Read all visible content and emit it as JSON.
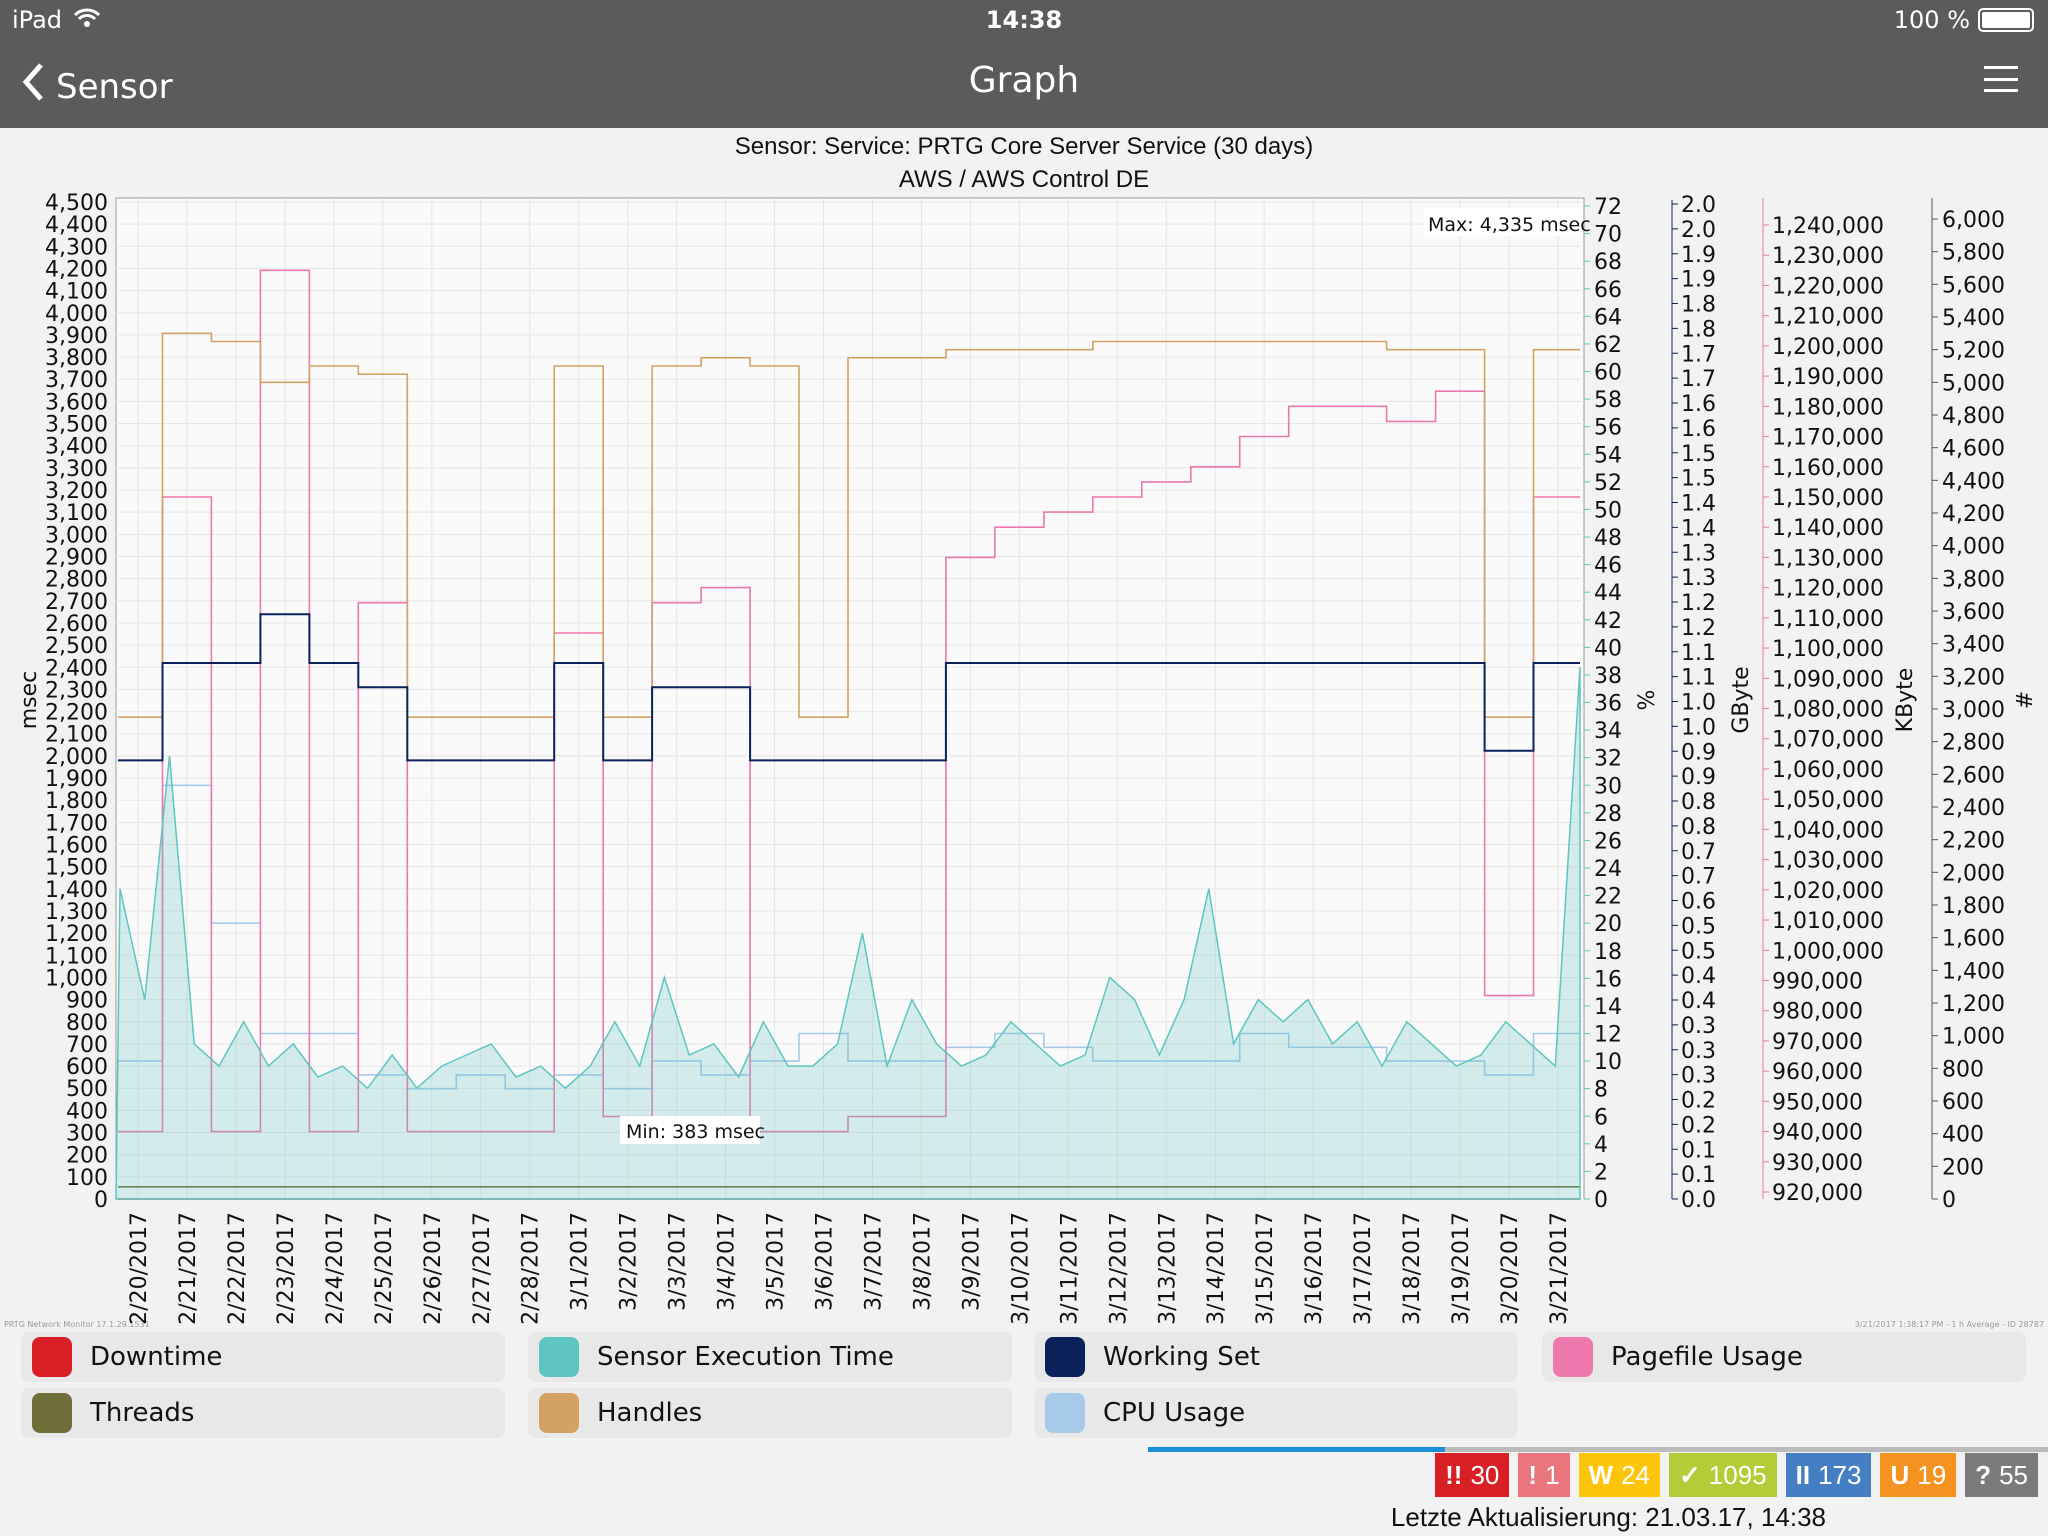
{
  "status_bar": {
    "device": "iPad",
    "time": "14:38",
    "battery": "100 %",
    "battery_level": 1.0
  },
  "nav": {
    "back_label": "Sensor",
    "title": "Graph"
  },
  "chart_header": {
    "line1": "Sensor: Service: PRTG Core Server Service (30 days)",
    "line2": "AWS / AWS Control DE"
  },
  "footer": {
    "left": "PRTG Network Monitor 17.1.29.1531",
    "right": "3/21/2017 1:38:17 PM - 1 h Average - ID 28787"
  },
  "chart_data": {
    "type": "line",
    "annotations": {
      "max": "Max: 4,335 msec",
      "min": "Min: 383 msec"
    },
    "grid": true,
    "x_ticks": [
      "2/20/2017",
      "2/21/2017",
      "2/22/2017",
      "2/23/2017",
      "2/24/2017",
      "2/25/2017",
      "2/26/2017",
      "2/27/2017",
      "2/28/2017",
      "3/1/2017",
      "3/2/2017",
      "3/3/2017",
      "3/4/2017",
      "3/5/2017",
      "3/6/2017",
      "3/7/2017",
      "3/8/2017",
      "3/9/2017",
      "3/10/2017",
      "3/11/2017",
      "3/12/2017",
      "3/13/2017",
      "3/14/2017",
      "3/15/2017",
      "3/16/2017",
      "3/17/2017",
      "3/18/2017",
      "3/19/2017",
      "3/20/2017",
      "3/21/2017"
    ],
    "axes": {
      "msec": {
        "label": "msec",
        "range": [
          0,
          4500
        ],
        "ticks": [
          "0",
          "100",
          "200",
          "300",
          "400",
          "500",
          "600",
          "700",
          "800",
          "900",
          "1,000",
          "1,100",
          "1,200",
          "1,300",
          "1,400",
          "1,500",
          "1,600",
          "1,700",
          "1,800",
          "1,900",
          "2,000",
          "2,100",
          "2,200",
          "2,300",
          "2,400",
          "2,500",
          "2,600",
          "2,700",
          "2,800",
          "2,900",
          "3,000",
          "3,100",
          "3,200",
          "3,300",
          "3,400",
          "3,500",
          "3,600",
          "3,700",
          "3,800",
          "3,900",
          "4,000",
          "4,100",
          "4,200",
          "4,300",
          "4,400",
          "4,500"
        ]
      },
      "percent": {
        "label": "%",
        "range": [
          0,
          72
        ],
        "ticks": [
          "0",
          "2",
          "4",
          "6",
          "8",
          "10",
          "12",
          "14",
          "16",
          "18",
          "20",
          "22",
          "24",
          "26",
          "28",
          "30",
          "32",
          "34",
          "36",
          "38",
          "40",
          "42",
          "44",
          "46",
          "48",
          "50",
          "52",
          "54",
          "56",
          "58",
          "60",
          "62",
          "64",
          "66",
          "68",
          "70",
          "72"
        ]
      },
      "gbyte": {
        "label": "GByte",
        "range": [
          0,
          2.05
        ],
        "ticks": [
          "0.0",
          "0.1",
          "0.1",
          "0.2",
          "0.2",
          "0.3",
          "0.3",
          "0.3",
          "0.4",
          "0.4",
          "0.5",
          "0.5",
          "0.6",
          "0.7",
          "0.7",
          "0.8",
          "0.8",
          "0.9",
          "0.9",
          "1.0",
          "1.0",
          "1.1",
          "1.1",
          "1.2",
          "1.2",
          "1.3",
          "1.3",
          "1.4",
          "1.4",
          "1.5",
          "1.5",
          "1.6",
          "1.6",
          "1.7",
          "1.7",
          "1.8",
          "1.8",
          "1.9",
          "1.9",
          "2.0",
          "2.0"
        ]
      },
      "kbyte": {
        "label": "KByte",
        "range": [
          920000,
          1240000
        ],
        "ticks": [
          "920,000",
          "930,000",
          "940,000",
          "950,000",
          "960,000",
          "970,000",
          "980,000",
          "990,000",
          "1,000,000",
          "1,010,000",
          "1,020,000",
          "1,030,000",
          "1,040,000",
          "1,050,000",
          "1,060,000",
          "1,070,000",
          "1,080,000",
          "1,090,000",
          "1,100,000",
          "1,110,000",
          "1,120,000",
          "1,130,000",
          "1,140,000",
          "1,150,000",
          "1,160,000",
          "1,170,000",
          "1,180,000",
          "1,190,000",
          "1,200,000",
          "1,210,000",
          "1,220,000",
          "1,230,000",
          "1,240,000"
        ]
      },
      "count": {
        "label": "#",
        "range": [
          0,
          6000
        ],
        "ticks": [
          "0",
          "200",
          "400",
          "600",
          "800",
          "1,000",
          "1,200",
          "1,400",
          "1,600",
          "1,800",
          "2,000",
          "2,200",
          "2,400",
          "2,600",
          "2,800",
          "3,000",
          "3,200",
          "3,400",
          "3,600",
          "3,800",
          "4,000",
          "4,200",
          "4,400",
          "4,600",
          "4,800",
          "5,000",
          "5,200",
          "5,400",
          "5,600",
          "5,800",
          "6,000"
        ]
      }
    },
    "series": [
      {
        "name": "Downtime",
        "axis": "percent",
        "color": "#d81f26",
        "values": [
          0,
          0,
          0,
          0,
          0,
          0,
          0,
          0,
          0,
          0,
          0,
          0,
          0,
          0,
          0,
          0,
          0,
          0,
          0,
          0,
          0,
          0,
          0,
          0,
          0,
          0,
          0,
          0,
          0,
          0
        ]
      },
      {
        "name": "Threads",
        "axis": "count",
        "color": "#6f6f3a",
        "values": [
          75,
          75,
          75,
          75,
          75,
          75,
          75,
          75,
          75,
          75,
          75,
          75,
          75,
          75,
          75,
          75,
          75,
          75,
          75,
          75,
          75,
          75,
          75,
          75,
          75,
          75,
          75,
          75,
          75,
          75
        ]
      },
      {
        "name": "CPU Usage",
        "axis": "percent",
        "color": "#a7c9ea",
        "values": [
          10,
          30,
          20,
          12,
          12,
          9,
          8,
          9,
          8,
          9,
          8,
          10,
          9,
          10,
          12,
          10,
          10,
          11,
          12,
          11,
          10,
          10,
          10,
          12,
          11,
          11,
          10,
          10,
          9,
          12
        ]
      },
      {
        "name": "Pagefile Usage",
        "axis": "kbyte",
        "color": "#ec78ad",
        "values": [
          940000,
          1150000,
          940000,
          1225000,
          940000,
          1115000,
          940000,
          940000,
          940000,
          1105000,
          945000,
          1115000,
          1120000,
          940000,
          940000,
          945000,
          945000,
          1130000,
          1140000,
          1145000,
          1150000,
          1155000,
          1160000,
          1170000,
          1180000,
          1180000,
          1175000,
          1185000,
          985000,
          1150000
        ]
      },
      {
        "name": "Handles",
        "axis": "count",
        "color": "#d3a263",
        "values": [
          2950,
          5300,
          5250,
          5000,
          5100,
          5050,
          2950,
          2950,
          2950,
          5100,
          2950,
          5100,
          5150,
          5100,
          2950,
          5150,
          5150,
          5200,
          5200,
          5200,
          5250,
          5250,
          5250,
          5250,
          5250,
          5250,
          5200,
          5200,
          2950,
          5200
        ]
      },
      {
        "name": "Working Set",
        "axis": "gbyte",
        "color": "#0a2159",
        "values": [
          0.9,
          1.1,
          1.1,
          1.2,
          1.1,
          1.05,
          0.9,
          0.9,
          0.9,
          1.1,
          0.9,
          1.05,
          1.05,
          0.9,
          0.9,
          0.9,
          0.9,
          1.1,
          1.1,
          1.1,
          1.1,
          1.1,
          1.1,
          1.1,
          1.1,
          1.1,
          1.1,
          1.1,
          0.92,
          1.1
        ]
      },
      {
        "name": "Sensor Execution Time",
        "axis": "msec",
        "color": "#5ec5c0",
        "values": [
          1400,
          900,
          2000,
          700,
          600,
          800,
          600,
          700,
          550,
          600,
          500,
          650,
          500,
          600,
          650,
          700,
          550,
          600,
          500,
          600,
          800,
          600,
          1000,
          650,
          700,
          550,
          800,
          600,
          600,
          700,
          1200,
          600,
          900,
          700,
          600,
          650,
          800,
          700,
          600,
          650,
          1000,
          900,
          650,
          900,
          1400,
          700,
          900,
          800,
          900,
          700,
          800,
          600,
          800,
          700,
          600,
          650,
          800,
          700,
          600,
          2400
        ]
      }
    ]
  },
  "legend": [
    {
      "label": "Downtime",
      "color": "#d81f26"
    },
    {
      "label": "Sensor Execution Time",
      "color": "#5ec5c0"
    },
    {
      "label": "Working Set",
      "color": "#0a2159"
    },
    {
      "label": "Pagefile Usage",
      "color": "#ec78ad"
    },
    {
      "label": "Threads",
      "color": "#6f6f3a"
    },
    {
      "label": "Handles",
      "color": "#d3a263"
    },
    {
      "label": "CPU Usage",
      "color": "#a7c9ea"
    }
  ],
  "loading_progress": 0.33,
  "badges": [
    {
      "icon": "!!",
      "count": "30",
      "color": "#d71f26",
      "name": "down"
    },
    {
      "icon": "!",
      "count": "1",
      "color": "#e8767c",
      "name": "down-partial"
    },
    {
      "icon": "W",
      "count": "24",
      "color": "#fec50d",
      "name": "warning"
    },
    {
      "icon": "✓",
      "count": "1095",
      "color": "#b3cc37",
      "name": "up"
    },
    {
      "icon": "II",
      "count": "173",
      "color": "#457fc3",
      "name": "paused"
    },
    {
      "icon": "U",
      "count": "19",
      "color": "#f59321",
      "name": "unusual"
    },
    {
      "icon": "?",
      "count": "55",
      "color": "#7b7b7b",
      "name": "unknown"
    }
  ],
  "last_update": "Letzte Aktualisierung: 21.03.17, 14:38"
}
